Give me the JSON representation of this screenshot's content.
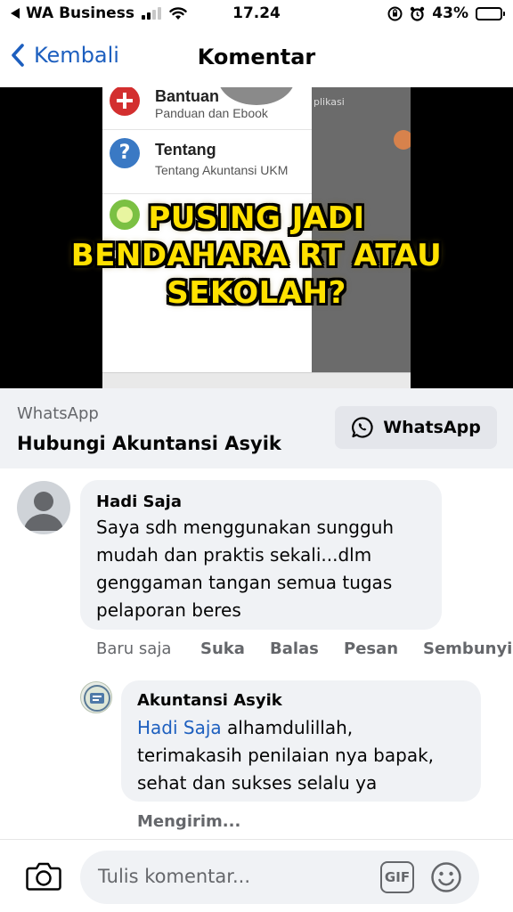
{
  "status_bar": {
    "carrier": "WA Business",
    "time": "17.24",
    "battery": "43%",
    "battery_level": 0.43
  },
  "nav": {
    "back_label": "Kembali",
    "title": "Komentar"
  },
  "ad": {
    "menu_items": [
      {
        "title": "Bantuan",
        "subtitle": "Panduan dan Ebook",
        "icon": "plus-icon",
        "color": "#d32f2f"
      },
      {
        "title": "Tentang",
        "subtitle": "Tentang Akuntansi UKM",
        "icon": "question-icon",
        "color": "#3a79c4"
      },
      {
        "title": "",
        "subtitle": "",
        "icon": "circle-icon",
        "color": "#7bc043"
      }
    ],
    "side_text": "plikasi",
    "headline": [
      "PUSING JADI",
      "BENDAHARA RT ATAU",
      "SEKOLAH?"
    ],
    "source": "WhatsApp",
    "name": "Hubungi Akuntansi Asyik",
    "cta_label": "WhatsApp",
    "headline_color": "#ffe100"
  },
  "comments": [
    {
      "author": "Hadi Saja",
      "text_lines": [
        "Saya sdh menggunakan sungguh",
        "mudah dan praktis sekali...dlm",
        "genggaman tangan semua tugas",
        "pelaporan beres"
      ],
      "time": "Baru saja",
      "actions": [
        "Suka",
        "Balas",
        "Pesan",
        "Sembunyi"
      ]
    }
  ],
  "reply": {
    "author": "Akuntansi Asyik",
    "mention": "Hadi Saja",
    "text_first": " alhamdulillah,",
    "text_lines": [
      "terimakasih penilaian nya bapak,",
      "sehat dan sukses selalu ya"
    ],
    "status": "Mengirim..."
  },
  "composer": {
    "placeholder": "Tulis komentar...",
    "gif_label": "GIF"
  },
  "colors": {
    "link": "#1d5fbf",
    "bubble": "#f0f2f5",
    "secondary_text": "#65676b"
  }
}
